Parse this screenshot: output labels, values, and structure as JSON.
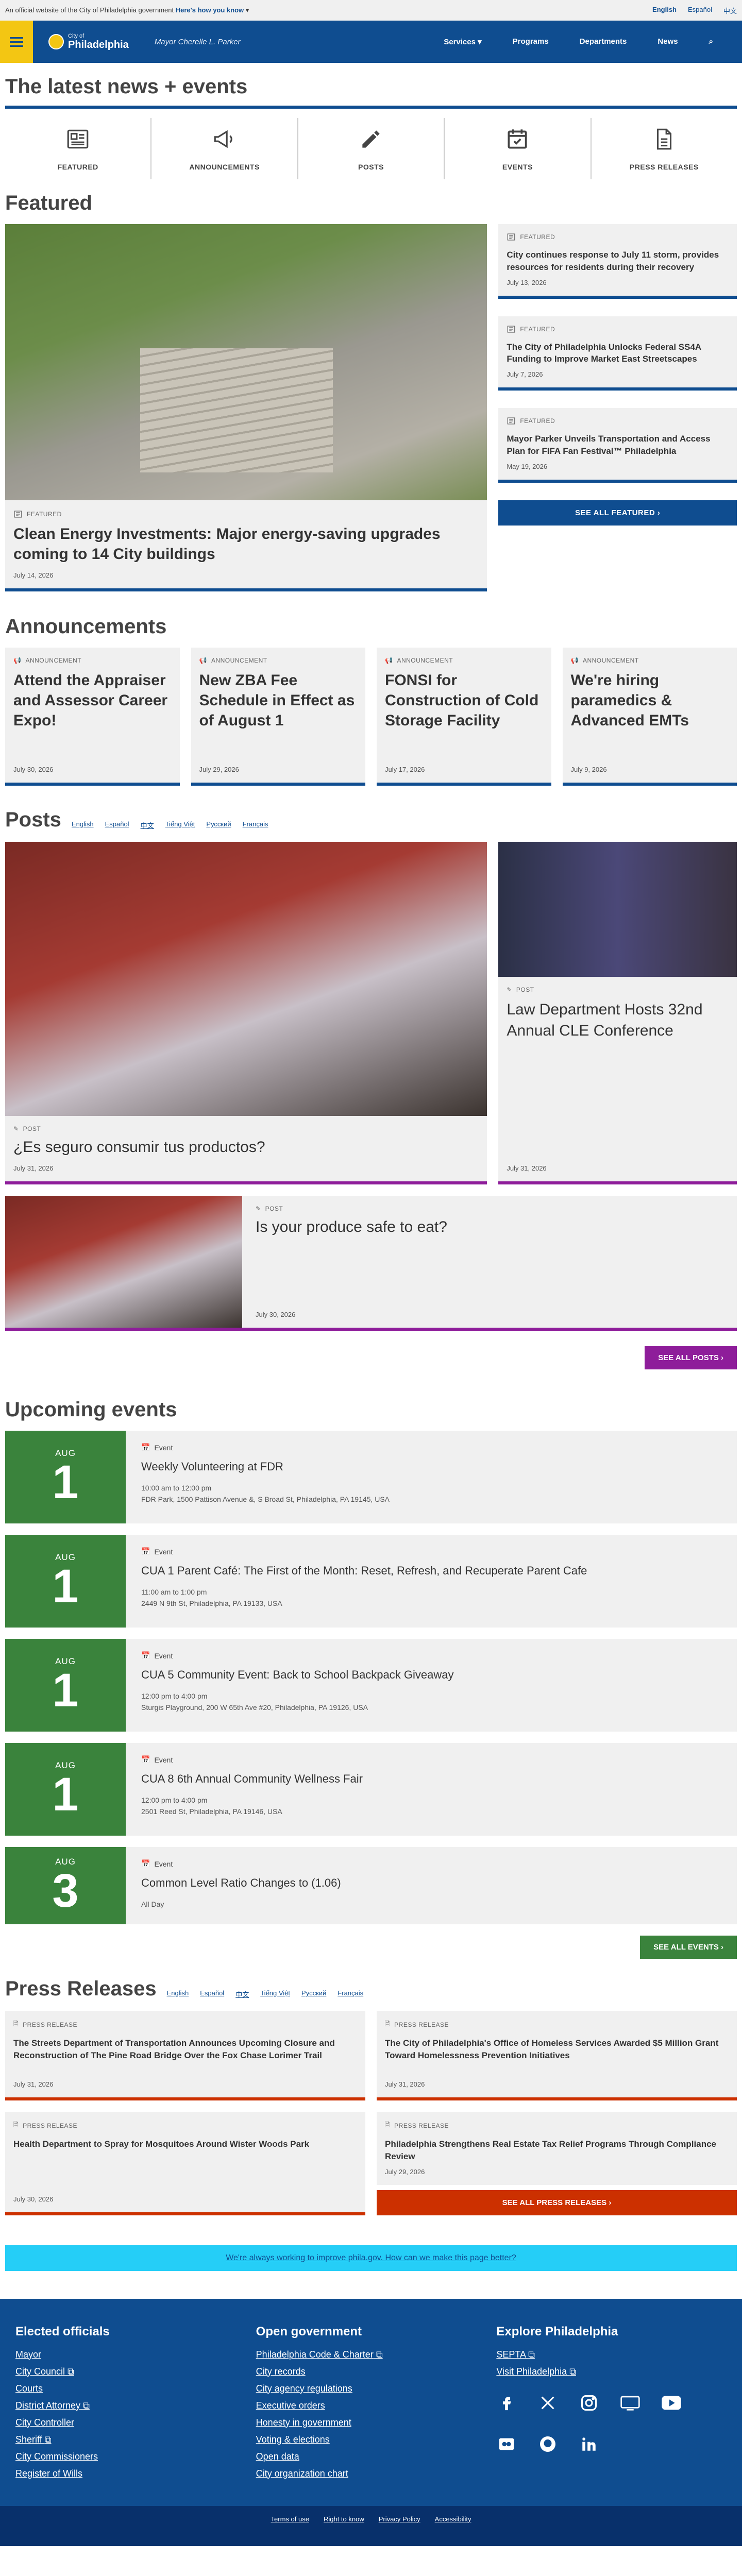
{
  "gov_banner": {
    "text": "An official website of the City of Philadelphia government",
    "link": "Here's how you know",
    "langs": [
      "English",
      "Español",
      "中文"
    ]
  },
  "header": {
    "logo_small": "City of",
    "logo_big": "Philadelphia",
    "mayor": "Mayor Cherelle L. Parker",
    "nav": [
      "Services",
      "Programs",
      "Departments",
      "News"
    ]
  },
  "page_title": "The latest news + events",
  "icon_nav": [
    "FEATURED",
    "ANNOUNCEMENTS",
    "POSTS",
    "EVENTS",
    "PRESS RELEASES"
  ],
  "featured": {
    "title": "Featured",
    "tag": "FEATURED",
    "main": {
      "title": "Clean Energy Investments: Major energy-saving upgrades coming to 14 City buildings",
      "date": "July 14, 2026"
    },
    "side": [
      {
        "title": "City continues response to July 11 storm, provides resources for residents during their recovery",
        "date": "July 13, 2026"
      },
      {
        "title": "The City of Philadelphia Unlocks Federal SS4A Funding to Improve Market East Streetscapes",
        "date": "July 7, 2026"
      },
      {
        "title": "Mayor Parker Unveils Transportation and Access Plan for FIFA Fan Festival™ Philadelphia",
        "date": "May 19, 2026"
      }
    ],
    "button": "SEE ALL FEATURED"
  },
  "announcements": {
    "title": "Announcements",
    "tag": "ANNOUNCEMENT",
    "items": [
      {
        "title": "Attend the Appraiser and Assessor Career Expo!",
        "date": "July 30, 2026"
      },
      {
        "title": "New ZBA Fee Schedule in Effect as of August 1",
        "date": "July 29, 2026"
      },
      {
        "title": "FONSI for Construction of Cold Storage Facility",
        "date": "July 17, 2026"
      },
      {
        "title": "We're hiring paramedics & Advanced EMTs",
        "date": "July 9, 2026"
      }
    ]
  },
  "posts": {
    "title": "Posts",
    "langs": [
      "English",
      "Español",
      "中文",
      "Tiếng Việt",
      "Русский",
      "Français"
    ],
    "tag": "POST",
    "main": {
      "title": "¿Es seguro consumir tus productos?",
      "date": "July 31, 2026"
    },
    "side": {
      "title": "Law Department Hosts 32nd Annual CLE Conference",
      "date": "July 31, 2026"
    },
    "wide": {
      "title": "Is your produce safe to eat?",
      "date": "July 30, 2026"
    },
    "button": "SEE ALL POSTS"
  },
  "events": {
    "title": "Upcoming events",
    "label": "Event",
    "items": [
      {
        "month": "AUG",
        "day": "1",
        "title": "Weekly Volunteering at FDR",
        "time": "10:00 am to 12:00 pm",
        "loc": "FDR Park, 1500 Pattison Avenue &, S Broad St, Philadelphia, PA 19145, USA"
      },
      {
        "month": "AUG",
        "day": "1",
        "title": "CUA 1 Parent Café: The First of the Month: Reset, Refresh, and Recuperate Parent Cafe",
        "time": "11:00 am to 1:00 pm",
        "loc": "2449 N 9th St, Philadelphia, PA 19133, USA"
      },
      {
        "month": "AUG",
        "day": "1",
        "title": "CUA 5 Community Event: Back to School Backpack Giveaway",
        "time": "12:00 pm to 4:00 pm",
        "loc": "Sturgis Playground, 200 W 65th Ave #20, Philadelphia, PA 19126, USA"
      },
      {
        "month": "AUG",
        "day": "1",
        "title": "CUA 8 6th Annual Community Wellness Fair",
        "time": "12:00 pm to 4:00 pm",
        "loc": "2501 Reed St, Philadelphia, PA 19146, USA"
      },
      {
        "month": "AUG",
        "day": "3",
        "title": "Common Level Ratio Changes to (1.06)",
        "time": "All Day",
        "loc": ""
      }
    ],
    "button": "SEE ALL EVENTS"
  },
  "press": {
    "title": "Press Releases",
    "langs": [
      "English",
      "Español",
      "中文",
      "Tiếng Việt",
      "Русский",
      "Français"
    ],
    "tag": "PRESS RELEASE",
    "items": [
      {
        "title": "The Streets Department of Transportation Announces Upcoming Closure and Reconstruction of The Pine Road Bridge Over the Fox Chase Lorimer Trail",
        "date": "July 31, 2026"
      },
      {
        "title": "The City of Philadelphia's Office of Homeless Services Awarded $5 Million Grant Toward Homelessness Prevention Initiatives",
        "date": "July 31, 2026"
      },
      {
        "title": "Health Department to Spray for Mosquitoes Around Wister Woods Park",
        "date": "July 30, 2026"
      },
      {
        "title": "Philadelphia Strengthens Real Estate Tax Relief Programs Through Compliance Review",
        "date": "July 29, 2026"
      }
    ],
    "button": "SEE ALL PRESS RELEASES"
  },
  "feedback": "We're always working to improve phila.gov. How can we make this page better?",
  "footer": {
    "c1": {
      "title": "Elected officials",
      "links": [
        "Mayor",
        "City Council",
        "Courts",
        "District Attorney",
        "City Controller",
        "Sheriff",
        "City Commissioners",
        "Register of Wills"
      ]
    },
    "c2": {
      "title": "Open government",
      "links": [
        "Philadelphia Code & Charter",
        "City records",
        "City agency regulations",
        "Executive orders",
        "Honesty in government",
        "Voting & elections",
        "Open data",
        "City organization chart"
      ]
    },
    "c3": {
      "title": "Explore Philadelphia",
      "links": [
        "SEPTA",
        "Visit Philadelphia"
      ]
    },
    "bottom": [
      "Terms of use",
      "Right to know",
      "Privacy Policy",
      "Accessibility"
    ]
  }
}
